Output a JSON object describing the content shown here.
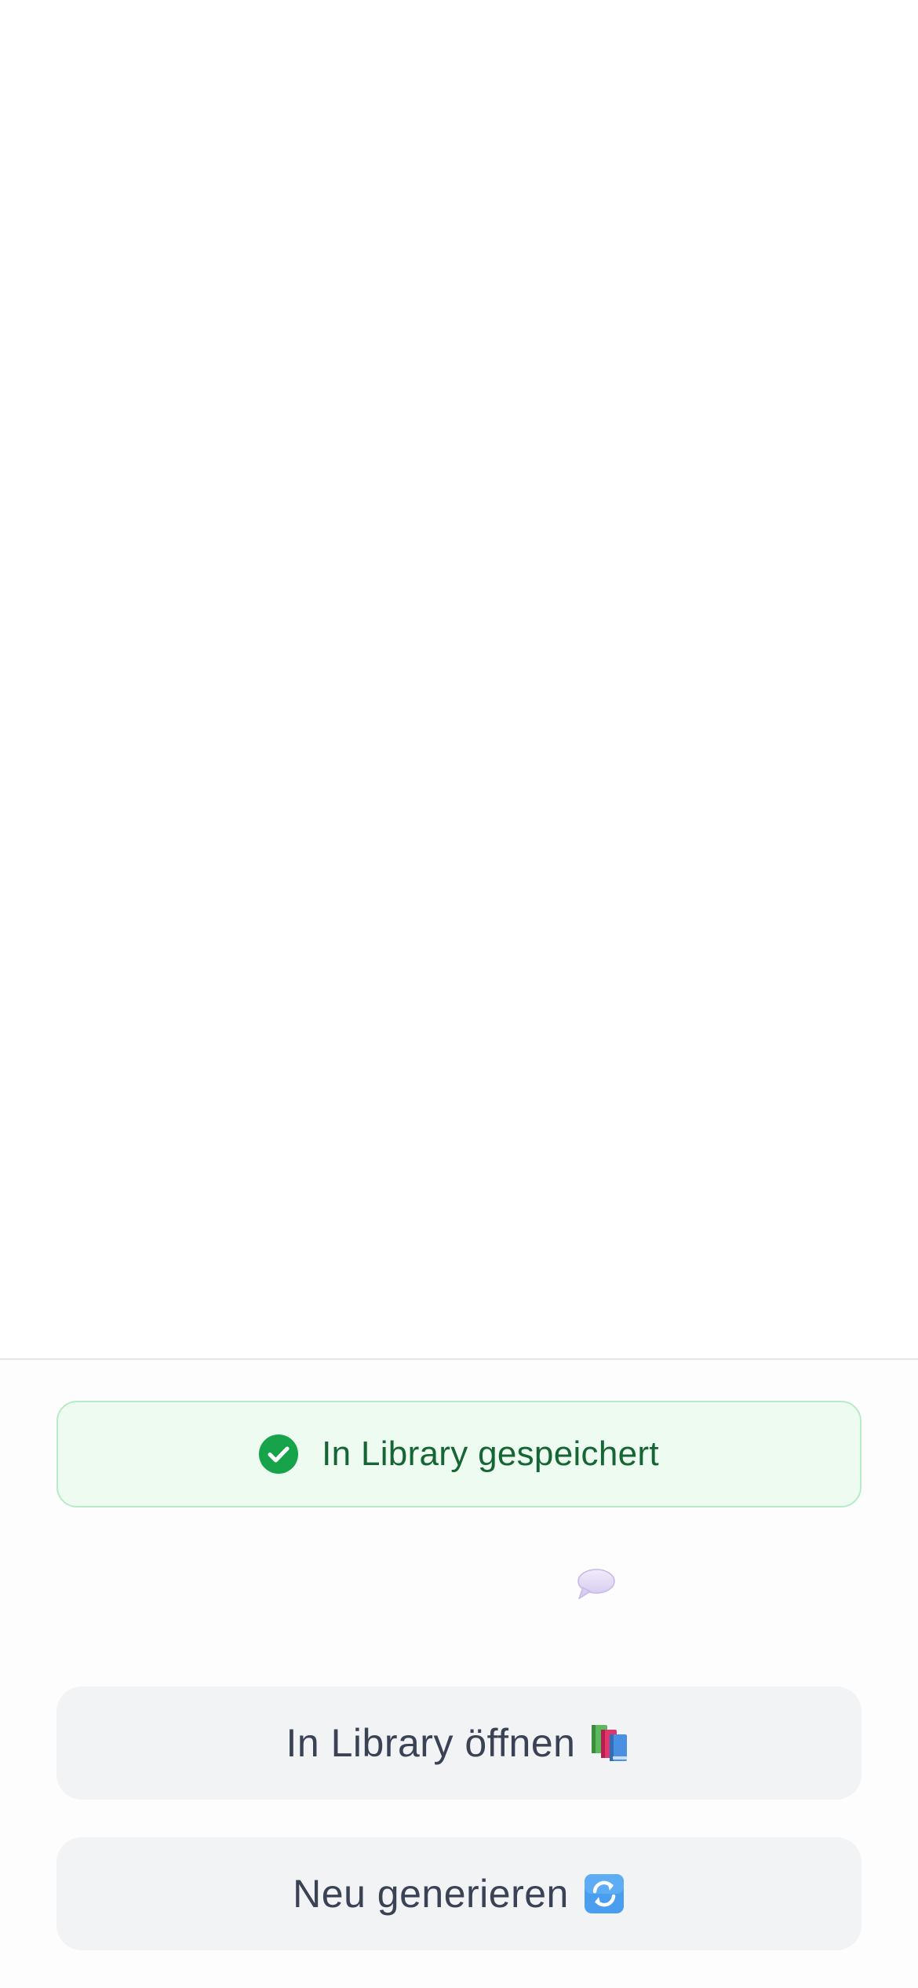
{
  "banner": {
    "text": "In Library gespeichert",
    "icon": "check-circle-icon",
    "color": "#16a34a"
  },
  "feedback": {
    "icon": "speech-bubble-icon"
  },
  "actions": {
    "open_label": "In Library öffnen",
    "open_icon": "books-icon",
    "regenerate_label": "Neu generieren",
    "regenerate_icon": "refresh-icon"
  }
}
